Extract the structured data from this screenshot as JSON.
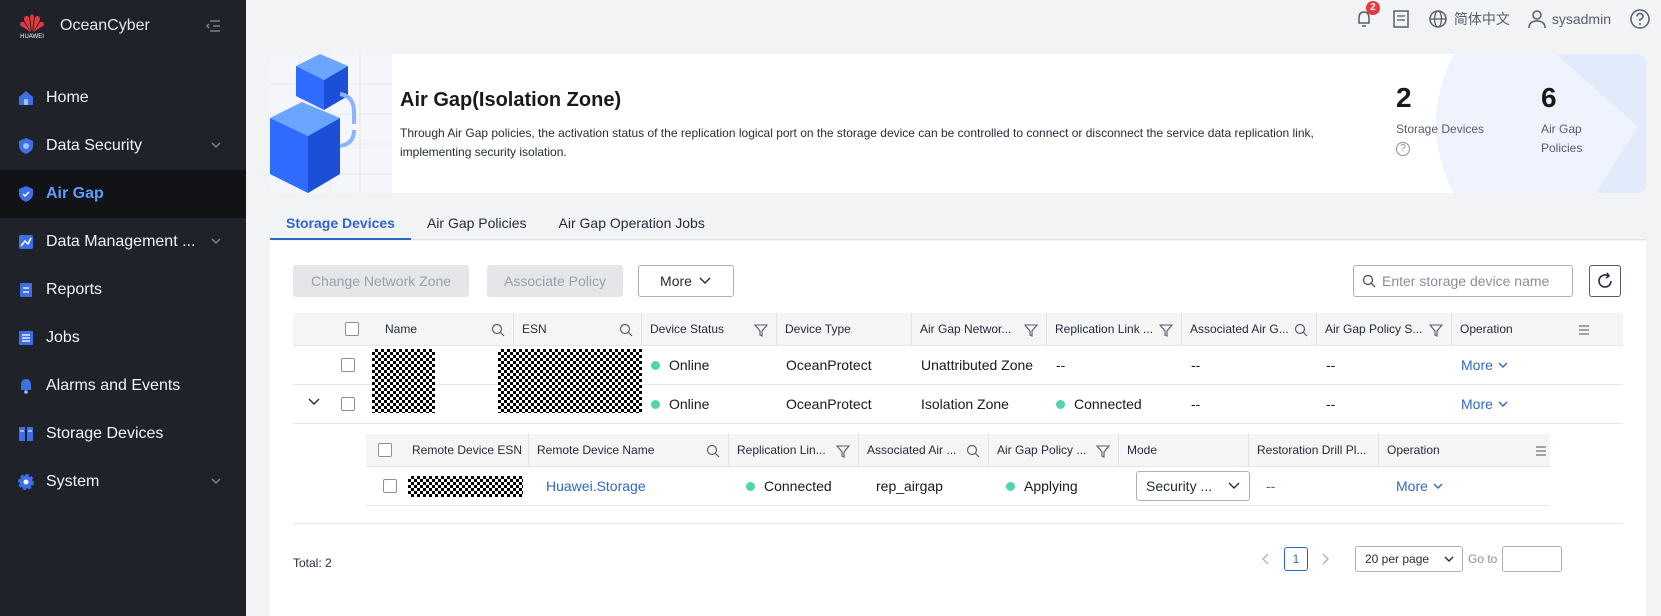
{
  "app": {
    "name": "OceanCyber",
    "logo_text": "HUAWEI"
  },
  "sidebar": {
    "items": [
      {
        "label": "Home",
        "icon": "home-icon"
      },
      {
        "label": "Data Security",
        "icon": "shield-icon"
      },
      {
        "label": "Air Gap",
        "icon": "air-gap-icon"
      },
      {
        "label": "Data Management ...",
        "icon": "data-management-icon"
      },
      {
        "label": "Reports",
        "icon": "reports-icon"
      },
      {
        "label": "Jobs",
        "icon": "jobs-icon"
      },
      {
        "label": "Alarms and Events",
        "icon": "bell-icon"
      },
      {
        "label": "Storage Devices",
        "icon": "storage-icon"
      },
      {
        "label": "System",
        "icon": "gear-icon"
      }
    ]
  },
  "topbar": {
    "notification_count": "2",
    "language": "简体中文",
    "user": "sysadmin"
  },
  "hero": {
    "title": "Air Gap(Isolation Zone)",
    "description": "Through Air Gap policies, the activation status of the replication logical port on the storage device can be controlled to connect or disconnect the service data replication link, implementing security isolation.",
    "stats": [
      {
        "value": "2",
        "label": "Storage Devices"
      },
      {
        "value": "6",
        "label": "Air Gap Policies"
      }
    ]
  },
  "tabs": [
    "Storage Devices",
    "Air Gap Policies",
    "Air Gap Operation Jobs"
  ],
  "toolbar": {
    "change_zone": "Change Network Zone",
    "associate_policy": "Associate Policy",
    "more": "More",
    "search_placeholder": "Enter storage device name"
  },
  "table": {
    "headers": [
      "Name",
      "ESN",
      "Device Status",
      "Device Type",
      "Air Gap Networ...",
      "Replication Link ...",
      "Associated Air G...",
      "Air Gap Policy S...",
      "Operation"
    ],
    "rows": [
      {
        "status": "Online",
        "type": "OceanProtect",
        "zone": "Unattributed Zone",
        "link": "--",
        "assoc": "--",
        "policy_status": "--",
        "op": "More"
      },
      {
        "status": "Online",
        "type": "OceanProtect",
        "zone": "Isolation Zone",
        "link": "Connected",
        "assoc": "--",
        "policy_status": "--",
        "op": "More"
      }
    ]
  },
  "subtable": {
    "headers": [
      "Remote Device ESN",
      "Remote Device Name",
      "Replication Lin...",
      "Associated Air ...",
      "Air Gap Policy ...",
      "Mode",
      "Restoration Drill Pl...",
      "Operation"
    ],
    "row": {
      "name": "Huawei.Storage",
      "link": "Connected",
      "assoc": "rep_airgap",
      "policy": "Applying",
      "mode": "Security ...",
      "drill": "--",
      "op": "More"
    }
  },
  "footer": {
    "total": "Total: 2",
    "page": "1",
    "page_size": "20 per page",
    "goto": "Go to"
  },
  "colors": {
    "accent": "#2f67c9",
    "online": "#50d4ab",
    "sidebar": "#1f2229"
  }
}
